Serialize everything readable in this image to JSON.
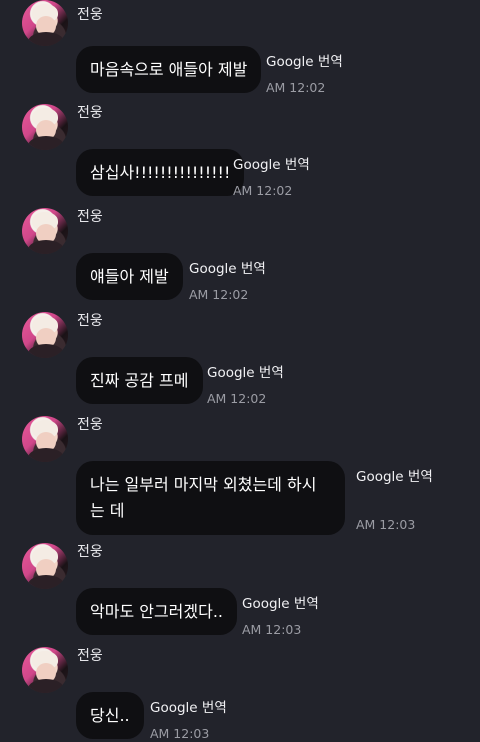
{
  "messages": [
    {
      "sender": "전웅",
      "text": "마음속으로 애들아 제발",
      "translate": "Google 번역",
      "time": "AM 12:02"
    },
    {
      "sender": "전웅",
      "text": "삼십사!!!!!!!!!!!!!!!",
      "translate": "Google 번역",
      "time": "AM 12:02"
    },
    {
      "sender": "전웅",
      "text": "얘들아 제발",
      "translate": "Google 번역",
      "time": "AM 12:02"
    },
    {
      "sender": "전웅",
      "text": "진짜 공감 프메",
      "translate": "Google 번역",
      "time": "AM 12:02"
    },
    {
      "sender": "전웅",
      "text": "나는 일부러 마지막 외쳤는데 하시는 데",
      "translate": "Google 번역",
      "time": "AM 12:03"
    },
    {
      "sender": "전웅",
      "text": "악마도 안그러겠다..",
      "translate": "Google 번역",
      "time": "AM 12:03"
    },
    {
      "sender": "전웅",
      "text": "당신..",
      "translate": "Google 번역",
      "time": "AM 12:03"
    }
  ]
}
